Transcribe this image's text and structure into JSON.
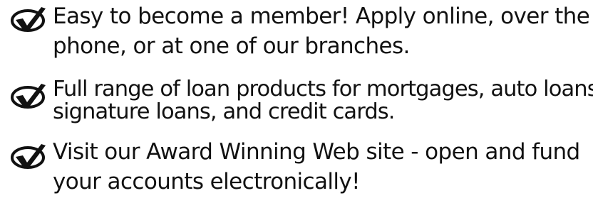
{
  "items": [
    {
      "icon": "check-in-circle-icon",
      "lines": [
        "Easy to become a member! Apply online, over the",
        "phone, or at one of our branches."
      ]
    },
    {
      "icon": "check-in-circle-icon",
      "lines": [
        "Full range of loan products for mortgages, auto loans,",
        "signature loans, and credit cards."
      ]
    },
    {
      "icon": "check-in-circle-icon",
      "lines": [
        "Visit our Award Winning Web site - open and fund",
        "your accounts electronically!"
      ]
    }
  ],
  "colors": {
    "text": "#111111",
    "background": "#ffffff"
  }
}
